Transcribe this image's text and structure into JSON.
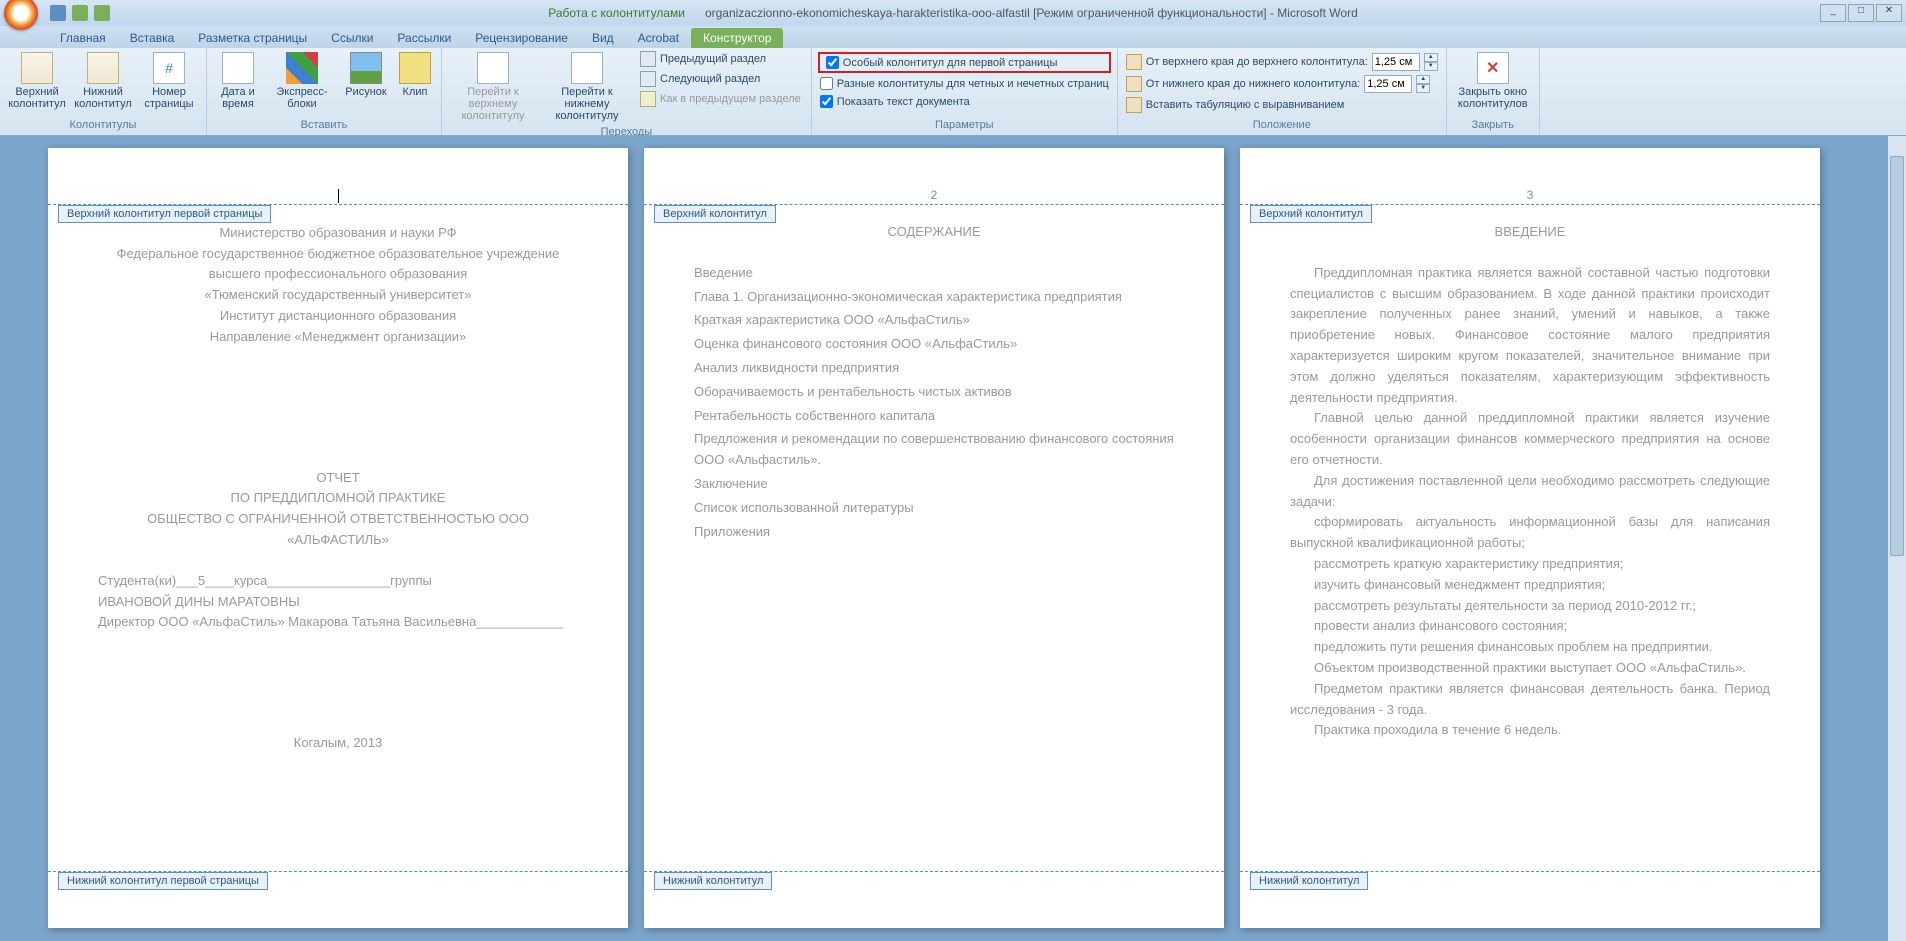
{
  "titlebar": {
    "context_title": "Работа с колонтитулами",
    "doc_title": "organizaczionno-ekonomicheskaya-harakteristika-ooo-alfastil [Режим ограниченной функциональности] - Microsoft Word"
  },
  "tabs": {
    "items": [
      "Главная",
      "Вставка",
      "Разметка страницы",
      "Ссылки",
      "Рассылки",
      "Рецензирование",
      "Вид",
      "Acrobat"
    ],
    "context_tab": "Конструктор"
  },
  "ribbon": {
    "group1": {
      "label": "Колонтитулы",
      "btn1": "Верхний колонтитул",
      "btn2": "Нижний колонтитул",
      "btn3": "Номер страницы"
    },
    "group2": {
      "label": "Вставить",
      "btn1": "Дата и время",
      "btn2": "Экспресс-блоки",
      "btn3": "Рисунок",
      "btn4": "Клип"
    },
    "group3": {
      "label": "Переходы",
      "btn1": "Перейти к верхнему колонтитулу",
      "btn2": "Перейти к нижнему колонтитулу",
      "item1": "Предыдущий раздел",
      "item2": "Следующий раздел",
      "item3": "Как в предыдущем разделе"
    },
    "group4": {
      "label": "Параметры",
      "chk1": "Особый колонтитул для первой страницы",
      "chk2": "Разные колонтитулы для четных и нечетных страниц",
      "chk3": "Показать текст документа"
    },
    "group5": {
      "label": "Положение",
      "row1": "От верхнего края до верхнего колонтитула:",
      "row2": "От нижнего края до нижнего колонтитула:",
      "row3": "Вставить табуляцию с выравниванием",
      "val1": "1,25 см",
      "val2": "1,25 см"
    },
    "group6": {
      "label": "Закрыть",
      "btn1": "Закрыть окно колонтитулов"
    }
  },
  "pages": {
    "p1": {
      "header_tag": "Верхний колонтитул первой страницы",
      "footer_tag": "Нижний колонтитул первой страницы",
      "lines": [
        "Министерство образования и науки РФ",
        "Федеральное государственное бюджетное образовательное учреждение",
        "высшего профессионального образования",
        "«Тюменский государственный университет»",
        "Институт дистанционного образования",
        "Направление «Менеджмент организации»"
      ],
      "report_title": "ОТЧЕТ",
      "report_sub1": "ПО ПРЕДДИПЛОМНОЙ ПРАКТИКЕ",
      "report_sub2": "ОБЩЕСТВО С ОГРАНИЧЕННОЙ ОТВЕТСТВЕННОСТЬЮ ООО",
      "report_sub3": "«АЛЬФАСТИЛЬ»",
      "student": "Студента(ки)___5____курса_________________группы",
      "name": "ИВАНОВОЙ ДИНЫ МАРАТОВНЫ",
      "director": "Директор ООО «АльфаСтиль» Макарова Татьяна Васильевна____________",
      "city": "Когалым, 2013"
    },
    "p2": {
      "num": "2",
      "header_tag": "Верхний колонтитул",
      "footer_tag": "Нижний колонтитул",
      "title": "СОДЕРЖАНИЕ",
      "toc": [
        "Введение",
        "Глава 1. Организационно-экономическая характеристика предприятия",
        "Краткая характеристика ООО «АльфаСтиль»",
        "Оценка финансового состояния ООО «АльфаСтиль»",
        "Анализ ликвидности предприятия",
        "Оборачиваемость и рентабельность чистых активов",
        "Рентабельность собственного капитала",
        "Предложения и рекомендации по совершенствованию финансового состояния ООО «Альфастиль».",
        "Заключение",
        "Список использованной литературы",
        "Приложения"
      ]
    },
    "p3": {
      "num": "3",
      "header_tag": "Верхний колонтитул",
      "footer_tag": "Нижний колонтитул",
      "title": "ВВЕДЕНИЕ",
      "para1": "Преддипломная практика является важной составной частью подготовки специалистов с высшим образованием. В ходе данной практики происходит закрепление полученных ранее знаний, умений и навыков, а также приобретение новых. Финансовое состояние малого предприятия характеризуется широким кругом показателей, значительное внимание при этом должно уделяться показателям, характеризующим эффективность деятельности предприятия.",
      "para2": "Главной целью данной преддипломной практики является изучение особенности организации финансов коммерческого предприятия на основе его отчетности.",
      "para3": "Для достижения поставленной цели необходимо рассмотреть следующие задачи:",
      "tasks": [
        "сформировать актуальность информационной базы для написания выпускной квалификационной работы;",
        "рассмотреть краткую характеристику предприятия;",
        "изучить финансовый менеджмент предприятия;",
        "рассмотреть результаты деятельности за период 2010-2012 гг.;",
        "провести анализ финансового состояния;",
        "предложить пути решения финансовых проблем на предприятии."
      ],
      "para4": "Объектом производственной практики выступает ООО «АльфаСтиль».",
      "para5": "Предметом практики является финансовая деятельность банка. Период исследования - 3 года.",
      "para6": "Практика проходила в течение 6 недель."
    }
  }
}
